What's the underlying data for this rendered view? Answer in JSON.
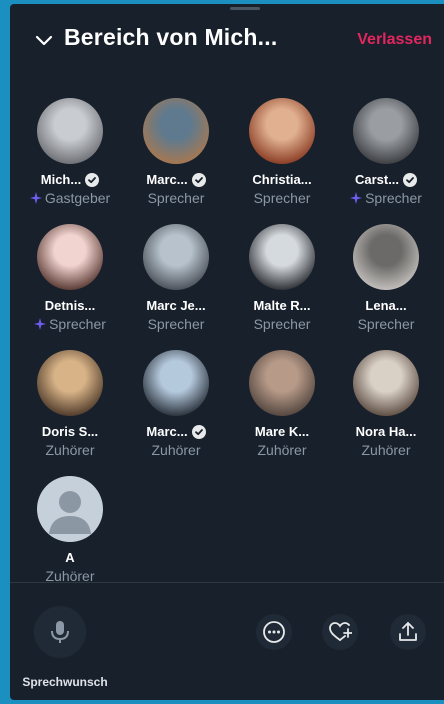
{
  "header": {
    "title": "Bereich von Mich...",
    "leave_label": "Verlassen"
  },
  "participants": [
    {
      "name": "Mich...",
      "role": "Gastgeber",
      "verified": true,
      "spark": true
    },
    {
      "name": "Marc...",
      "role": "Sprecher",
      "verified": true,
      "spark": false
    },
    {
      "name": "Christia...",
      "role": "Sprecher",
      "verified": false,
      "spark": false
    },
    {
      "name": "Carst...",
      "role": "Sprecher",
      "verified": true,
      "spark": true
    },
    {
      "name": "Detnis...",
      "role": "Sprecher",
      "verified": false,
      "spark": true
    },
    {
      "name": "Marc Je...",
      "role": "Sprecher",
      "verified": false,
      "spark": false
    },
    {
      "name": "Malte R...",
      "role": "Sprecher",
      "verified": false,
      "spark": false
    },
    {
      "name": "Lena...",
      "role": "Sprecher",
      "verified": false,
      "spark": false
    },
    {
      "name": "Doris S...",
      "role": "Zuhörer",
      "verified": false,
      "spark": false
    },
    {
      "name": "Marc...",
      "role": "Zuhörer",
      "verified": true,
      "spark": false
    },
    {
      "name": "Mare K...",
      "role": "Zuhörer",
      "verified": false,
      "spark": false
    },
    {
      "name": "Nora Ha...",
      "role": "Zuhörer",
      "verified": false,
      "spark": false
    },
    {
      "name": "A",
      "role": "Zuhörer",
      "verified": false,
      "spark": false
    }
  ],
  "footer": {
    "mic_label": "Sprechwunsch",
    "icons": [
      "microphone-icon",
      "more-icon",
      "heart-plus-icon",
      "share-icon"
    ]
  },
  "colors": {
    "accent": "#e2265e",
    "panel": "#18202b",
    "border": "#1a8fc0",
    "spark": "#6e5cf0"
  }
}
